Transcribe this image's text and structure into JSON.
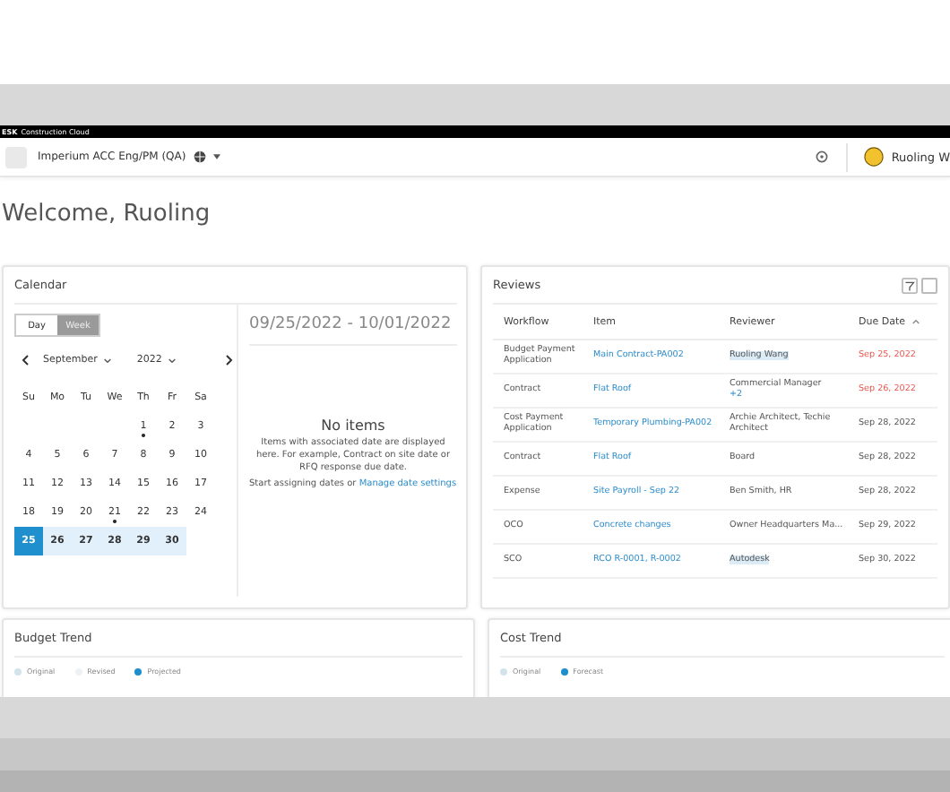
{
  "brand_bar": {
    "mark": "ESK",
    "product": "Construction Cloud"
  },
  "header": {
    "project": "Imperium ACC Eng/PM (QA)",
    "user": "Ruoling W"
  },
  "welcome": "Welcome, Ruoling",
  "calendar": {
    "title": "Calendar",
    "modes": [
      {
        "label": "Day",
        "selected": false
      },
      {
        "label": "Week",
        "selected": true
      }
    ],
    "month": "September",
    "year": "2022",
    "weekdays": [
      "Su",
      "Mo",
      "Tu",
      "We",
      "Th",
      "Fr",
      "Sa"
    ],
    "weeks": [
      [
        {
          "day": "1",
          "dot": true,
          "in_range": false,
          "selected": false
        },
        {
          "day": "2",
          "dot": false,
          "in_range": false,
          "selected": false
        },
        {
          "day": "3",
          "dot": false,
          "in_range": false,
          "selected": false
        }
      ],
      [
        {
          "day": "4",
          "dot": false,
          "in_range": false,
          "selected": false
        },
        {
          "day": "5",
          "dot": false,
          "in_range": false,
          "selected": false
        },
        {
          "day": "6",
          "dot": false,
          "in_range": false,
          "selected": false
        },
        {
          "day": "7",
          "dot": false,
          "in_range": false,
          "selected": false
        },
        {
          "day": "8",
          "dot": false,
          "in_range": false,
          "selected": false
        },
        {
          "day": "9",
          "dot": false,
          "in_range": false,
          "selected": false
        },
        {
          "day": "10",
          "dot": false,
          "in_range": false,
          "selected": false
        }
      ],
      [
        {
          "day": "11",
          "dot": false,
          "in_range": false,
          "selected": false
        },
        {
          "day": "12",
          "dot": false,
          "in_range": false,
          "selected": false
        },
        {
          "day": "13",
          "dot": false,
          "in_range": false,
          "selected": false
        },
        {
          "day": "14",
          "dot": false,
          "in_range": false,
          "selected": false
        },
        {
          "day": "15",
          "dot": false,
          "in_range": false,
          "selected": false
        },
        {
          "day": "16",
          "dot": false,
          "in_range": false,
          "selected": false
        },
        {
          "day": "17",
          "dot": false,
          "in_range": false,
          "selected": false
        }
      ],
      [
        {
          "day": "18",
          "dot": false,
          "in_range": false,
          "selected": false
        },
        {
          "day": "19",
          "dot": false,
          "in_range": false,
          "selected": false
        },
        {
          "day": "20",
          "dot": false,
          "in_range": false,
          "selected": false
        },
        {
          "day": "21",
          "dot": true,
          "in_range": false,
          "selected": false
        },
        {
          "day": "22",
          "dot": false,
          "in_range": false,
          "selected": false
        },
        {
          "day": "23",
          "dot": false,
          "in_range": false,
          "selected": false
        },
        {
          "day": "24",
          "dot": false,
          "in_range": false,
          "selected": false
        }
      ],
      [
        {
          "day": "25",
          "dot": false,
          "in_range": true,
          "selected": true
        },
        {
          "day": "26",
          "dot": false,
          "in_range": true,
          "selected": false
        },
        {
          "day": "27",
          "dot": false,
          "in_range": true,
          "selected": false
        },
        {
          "day": "28",
          "dot": false,
          "in_range": true,
          "selected": false
        },
        {
          "day": "29",
          "dot": false,
          "in_range": true,
          "selected": false
        },
        {
          "day": "30",
          "dot": false,
          "in_range": true,
          "selected": false
        }
      ]
    ],
    "range": "09/25/2022 - 10/01/2022",
    "empty_title": "No items",
    "empty_text": "Items with associated date are displayed here. For example, Contract on site date or RFQ response due date.",
    "hint": "Start assigning dates or",
    "hint_link": "Manage date settings"
  },
  "reviews": {
    "title": "Reviews",
    "columns": [
      "Workflow",
      "Item",
      "Reviewer",
      "Due Date"
    ],
    "rows": [
      {
        "workflow": "Budget Payment Application",
        "item": "Main Contract-PA002",
        "reviewer": "Ruoling Wang",
        "reviewer_highlight": true,
        "due": "Sep 25, 2022",
        "overdue": true
      },
      {
        "workflow": "Contract",
        "item": "Flat Roof",
        "reviewer": "Commercial Manager",
        "reviewer_more": "+2",
        "reviewer_highlight": false,
        "due": "Sep 26, 2022",
        "overdue": true
      },
      {
        "workflow": "Cost Payment Application",
        "item": "Temporary Plumbing-PA002",
        "reviewer": "Archie Architect, Techie Architect",
        "reviewer_highlight": false,
        "due": "Sep 28, 2022",
        "overdue": false
      },
      {
        "workflow": "Contract",
        "item": "Flat Roof",
        "reviewer": "Board",
        "reviewer_highlight": false,
        "due": "Sep 28, 2022",
        "overdue": false
      },
      {
        "workflow": "Expense",
        "item": "Site Payroll - Sep 22",
        "reviewer": "Ben Smith, HR",
        "reviewer_highlight": false,
        "due": "Sep 28, 2022",
        "overdue": false
      },
      {
        "workflow": "OCO",
        "item": "Concrete changes",
        "reviewer": "Owner Headquarters Ma...",
        "reviewer_highlight": false,
        "due": "Sep 29, 2022",
        "overdue": false
      },
      {
        "workflow": "SCO",
        "item": "RCO R-0001, R-0002",
        "reviewer": "Autodesk",
        "reviewer_highlight": true,
        "due": "Sep 30, 2022",
        "overdue": false
      }
    ]
  },
  "budget_trend": {
    "title": "Budget Trend",
    "legend": [
      {
        "label": "Original",
        "color": "#d3e3ec"
      },
      {
        "label": "Revised",
        "color": "#eef2f4"
      },
      {
        "label": "Projected",
        "color": "#1c8ec9"
      }
    ]
  },
  "cost_trend": {
    "title": "Cost Trend",
    "legend": [
      {
        "label": "Original",
        "color": "#d3e3ec"
      },
      {
        "label": "Forecast",
        "color": "#1c8ec9"
      }
    ]
  }
}
